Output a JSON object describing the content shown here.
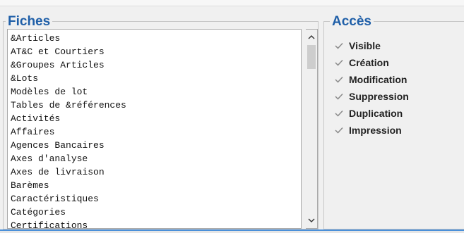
{
  "fiches": {
    "title": "Fiches",
    "items": [
      "&Articles",
      "AT&C et Courtiers",
      "&Groupes Articles",
      "&Lots",
      "Modèles de lot",
      "Tables de &références",
      "Activités",
      "Affaires",
      "Agences Bancaires",
      "Axes d'analyse",
      "Axes de livraison",
      "Barèmes",
      "Caractéristiques",
      "Catégories",
      "Certifications"
    ]
  },
  "acces": {
    "title": "Accès",
    "options": [
      {
        "label": "Visible",
        "checked": true
      },
      {
        "label": "Création",
        "checked": true
      },
      {
        "label": "Modification",
        "checked": true
      },
      {
        "label": "Suppression",
        "checked": true
      },
      {
        "label": "Duplication",
        "checked": true
      },
      {
        "label": "Impression",
        "checked": true
      }
    ]
  },
  "colors": {
    "title": "#1f5fa8",
    "checkmark": "#8a8a8a",
    "bottom_accent": "#4a90d9"
  },
  "icons": {
    "scroll_up": "chevron-up-icon",
    "scroll_down": "chevron-down-icon",
    "check": "checkmark-icon"
  }
}
